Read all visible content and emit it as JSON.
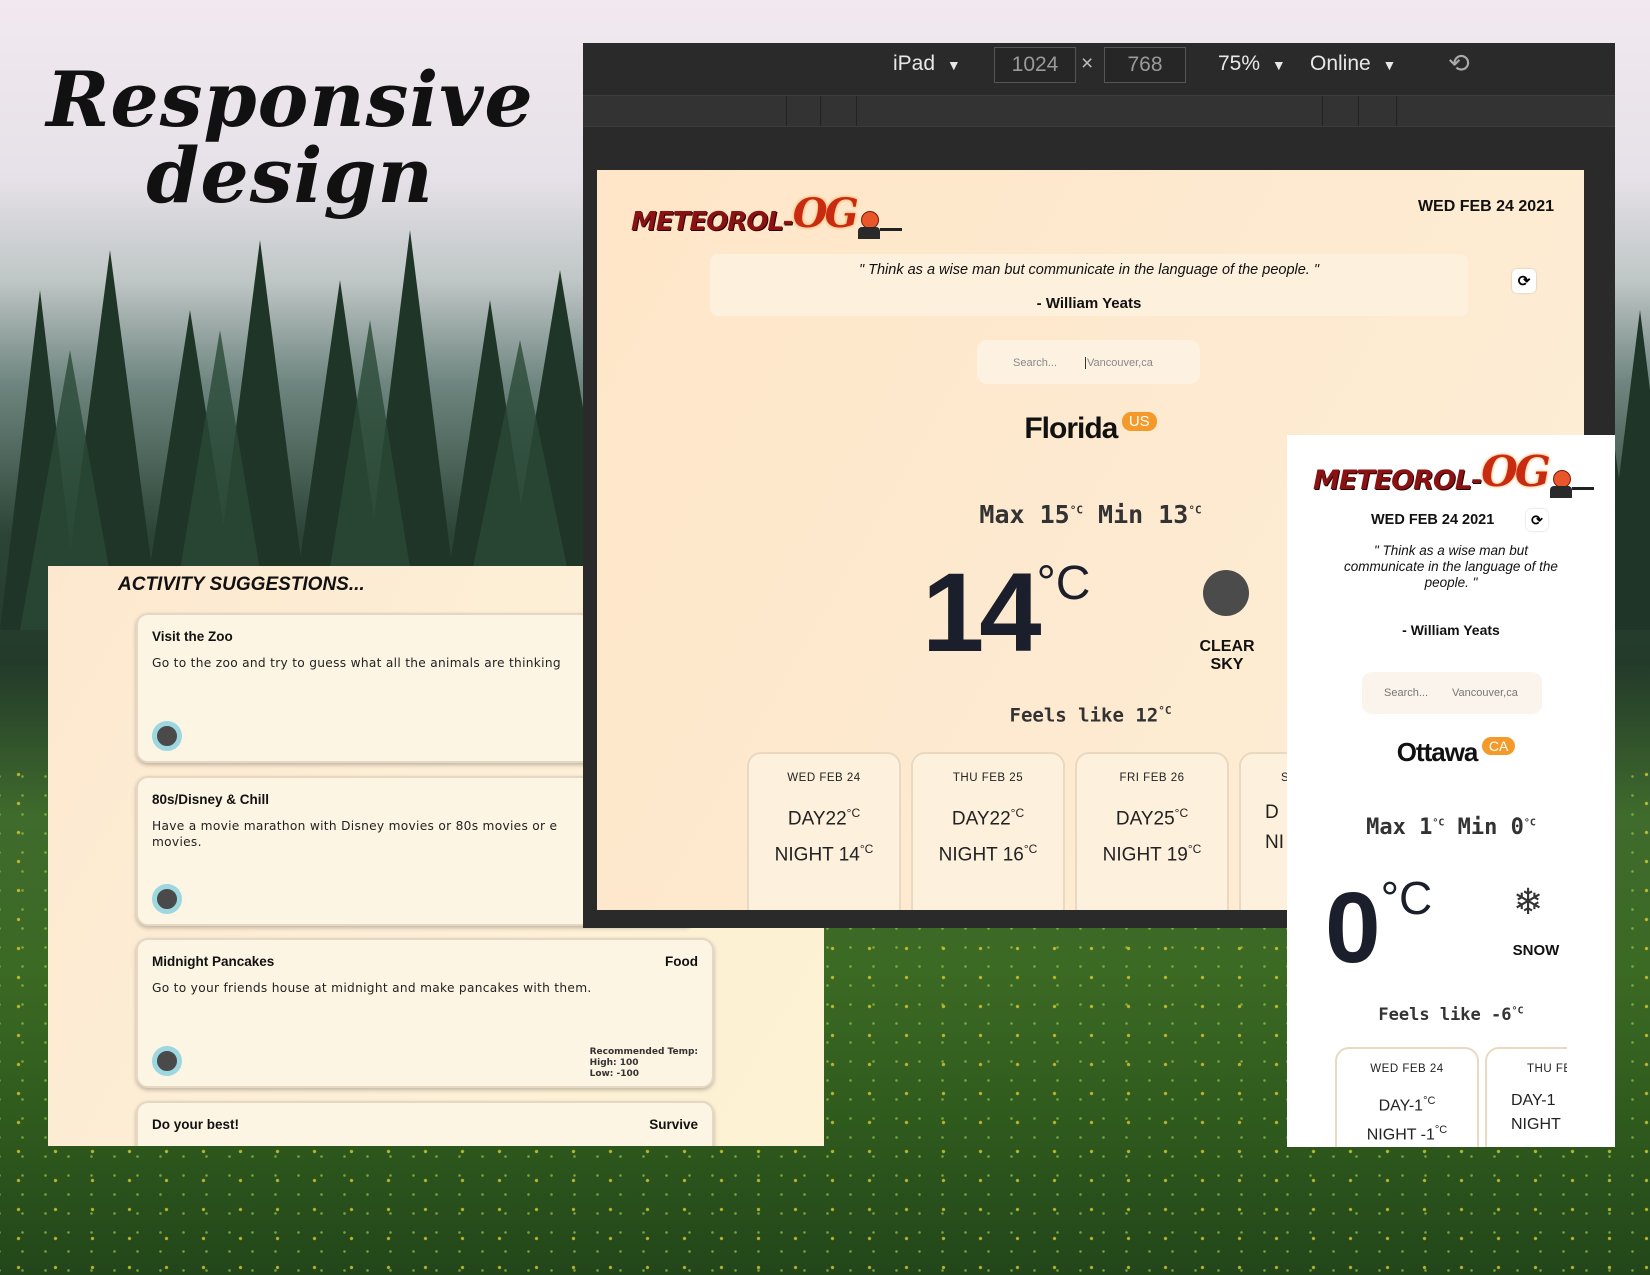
{
  "headline": {
    "line1": "Responsive",
    "line2": "design"
  },
  "logo": {
    "text": "METEOROL-",
    "og": "OG"
  },
  "devtools": {
    "device": "iPad",
    "width": "1024",
    "height": "768",
    "times": "×",
    "zoom": "75%",
    "network": "Online",
    "caret": "▼",
    "rotate_icon": "⟲"
  },
  "ipad": {
    "date": "WED FEB 24 2021",
    "quote": "\" Think as a wise man but communicate in the language of the people. \"",
    "author": "- William Yeats",
    "search_placeholder": "Search...",
    "search_value": "Vancouver,ca",
    "city": "Florida",
    "country": "US",
    "max_label": "Max",
    "max": "15",
    "min_label": "Min",
    "min": "13",
    "unit": "°C",
    "temp": "14",
    "condition_line1": "CLEAR",
    "condition_line2": "SKY",
    "feels_label": "Feels like",
    "feels": "12",
    "forecast": [
      {
        "date": "WED FEB 24",
        "day": "DAY22",
        "night": "NIGHT 14"
      },
      {
        "date": "THU FEB 25",
        "day": "DAY22",
        "night": "NIGHT 16"
      },
      {
        "date": "FRI FEB 26",
        "day": "DAY25",
        "night": "NIGHT 19"
      },
      {
        "date": "S",
        "day": "D",
        "night": "NI"
      }
    ]
  },
  "activities": {
    "title": "ACTIVITY SUGGESTIONS...",
    "items": [
      {
        "title": "Visit the Zoo",
        "category": "",
        "desc": "Go to the zoo and try to guess what all the animals are thinking",
        "rec": [
          "",
          "",
          ""
        ]
      },
      {
        "title": "80s/Disney & Chill",
        "category": "",
        "desc": "Have a movie marathon with Disney movies or 80s movies or e",
        "desc2": "movies.",
        "rec": [
          "",
          "",
          ""
        ]
      },
      {
        "title": "Midnight Pancakes",
        "category": "Food",
        "desc": "Go to your friends house at midnight and make pancakes with them.",
        "rec": [
          "Recommended Temp:",
          "High: 100",
          "Low: -100"
        ]
      },
      {
        "title": "Do your best!",
        "category": "Survive",
        "desc": "",
        "rec": [
          "",
          "",
          ""
        ]
      }
    ]
  },
  "mobile": {
    "date": "WED FEB 24 2021",
    "quote_l1": "\" Think as a wise man but",
    "quote_l2": "communicate in the language of the",
    "quote_l3": "people. \"",
    "author": "- William Yeats",
    "search_placeholder": "Search...",
    "search_value": "Vancouver,ca",
    "city": "Ottawa",
    "country": "CA",
    "max_label": "Max",
    "max": "1",
    "min_label": "Min",
    "min": "0",
    "unit": "°C",
    "temp": "0",
    "condition": "SNOW",
    "condition_icon": "❄",
    "feels_label": "Feels like",
    "feels": "-6",
    "forecast": [
      {
        "date": "WED FEB 24",
        "day": "DAY-1",
        "night": "NIGHT -1"
      },
      {
        "date": "THU FE",
        "day": "DAY-1",
        "night": "NIGHT"
      }
    ]
  },
  "refresh_icon": "⟳"
}
